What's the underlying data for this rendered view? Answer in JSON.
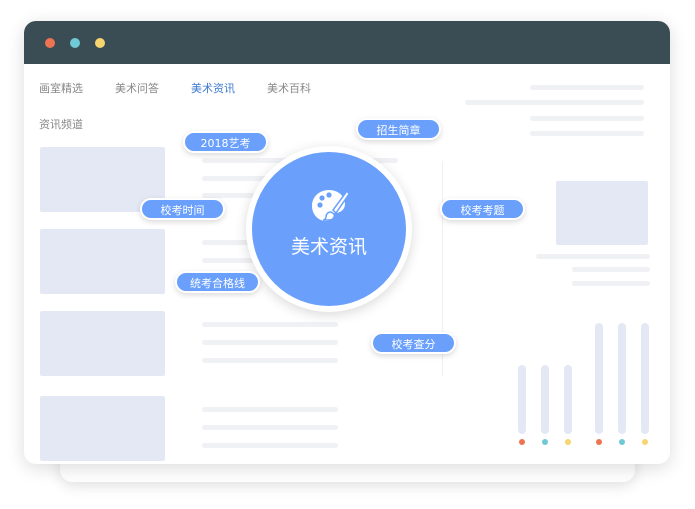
{
  "window": {
    "dots": [
      "#ee7352",
      "#6fcad6",
      "#f7d56f"
    ]
  },
  "nav": {
    "items": [
      "画室精选",
      "美术问答",
      "美术资讯",
      "美术百科"
    ],
    "active": 2,
    "section": "资讯频道"
  },
  "center": {
    "label": "美术资讯",
    "icon": "palette-icon",
    "color": "#6aa0fc"
  },
  "tags": [
    "2018艺考",
    "招生简章",
    "校考时间",
    "校考考题",
    "统考合格线",
    "校考查分"
  ],
  "bar_colors": [
    "#ee7352",
    "#6fcad6",
    "#f7d56f",
    "#ee7352",
    "#6fcad6",
    "#f7d56f"
  ]
}
